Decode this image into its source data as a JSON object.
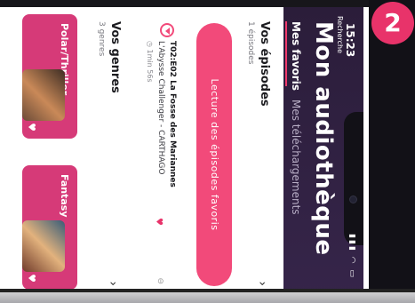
{
  "status": {
    "time": "15:23",
    "back": "Recherche",
    "icons": "▮▮▮ ◠ ▭"
  },
  "header": {
    "title": "Mon audiothèque",
    "tabs": [
      {
        "label": "Mes favoris"
      },
      {
        "label": "Mes téléchargements"
      }
    ]
  },
  "episodes": {
    "title": "Vos épisodes",
    "subtitle": "1 épisodes",
    "cta_label": "Lecture des épisodes favoris",
    "items": [
      {
        "title": "T02:E02 La Fosse des Mariannes",
        "subtitle": "L'Abysse Challenger - CARTHAGO",
        "duration": "1min 56s"
      }
    ]
  },
  "genres": {
    "title": "Vos genres",
    "subtitle": "3 genres",
    "cards": [
      {
        "name": "Polar/Thriller"
      },
      {
        "name": "Fantasy"
      }
    ]
  },
  "badge": {
    "number": "2"
  },
  "colors": {
    "accent": "#f24a7a",
    "header": "#2b1d3a",
    "genre": "#d63a78"
  },
  "icons": [
    "chevron-right-icon",
    "heart-icon",
    "play-icon",
    "download-icon",
    "signal-icon",
    "wifi-icon",
    "battery-icon"
  ]
}
